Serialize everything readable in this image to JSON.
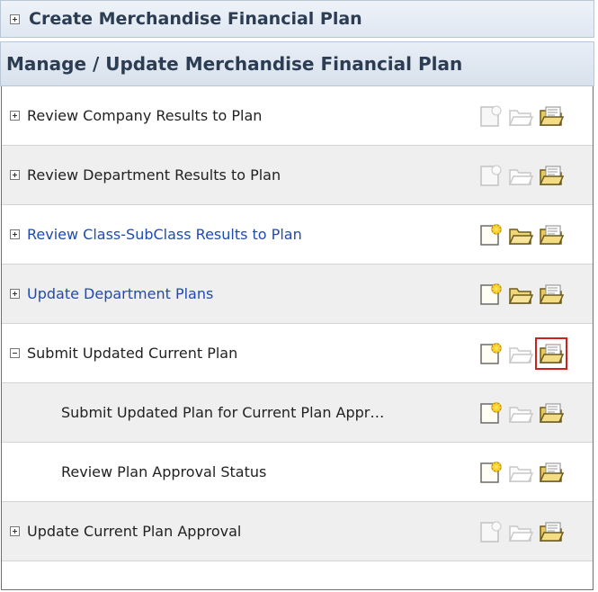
{
  "sections": {
    "create": {
      "title": "Create Merchandise Financial Plan"
    },
    "manage": {
      "title": "Manage / Update Merchandise Financial Plan"
    }
  },
  "rows": [
    {
      "label": "Review Company Results to Plan",
      "expander": "plus",
      "link": false,
      "child": false,
      "icons": {
        "new_enabled": false,
        "open_enabled": false,
        "openExisting_enabled": true
      }
    },
    {
      "label": "Review Department Results to Plan",
      "expander": "plus",
      "link": false,
      "child": false,
      "icons": {
        "new_enabled": false,
        "open_enabled": false,
        "openExisting_enabled": true
      }
    },
    {
      "label": "Review Class-SubClass Results to Plan",
      "expander": "plus",
      "link": true,
      "child": false,
      "icons": {
        "new_enabled": true,
        "open_enabled": true,
        "openExisting_enabled": true
      }
    },
    {
      "label": "Update Department Plans",
      "expander": "plus",
      "link": true,
      "child": false,
      "icons": {
        "new_enabled": true,
        "open_enabled": true,
        "openExisting_enabled": true
      }
    },
    {
      "label": "Submit Updated Current Plan",
      "expander": "minus",
      "link": false,
      "child": false,
      "icons": {
        "new_enabled": true,
        "open_enabled": false,
        "openExisting_enabled": true,
        "openExisting_highlighted": true
      }
    },
    {
      "label": "Submit Updated Plan for Current Plan Appr…",
      "expander": "none",
      "link": false,
      "child": true,
      "icons": {
        "new_enabled": true,
        "open_enabled": false,
        "openExisting_enabled": true
      }
    },
    {
      "label": "Review Plan Approval Status",
      "expander": "none",
      "link": false,
      "child": true,
      "icons": {
        "new_enabled": true,
        "open_enabled": false,
        "openExisting_enabled": true
      }
    },
    {
      "label": "Update Current Plan Approval",
      "expander": "plus",
      "link": false,
      "child": false,
      "icons": {
        "new_enabled": false,
        "open_enabled": false,
        "openExisting_enabled": true
      }
    }
  ],
  "icon_names": [
    "new-document-icon",
    "open-folder-icon",
    "open-existing-folder-icon"
  ],
  "colors": {
    "link": "#1f4bb0",
    "highlight": "#d0201b",
    "alt_row": "#efefef"
  }
}
